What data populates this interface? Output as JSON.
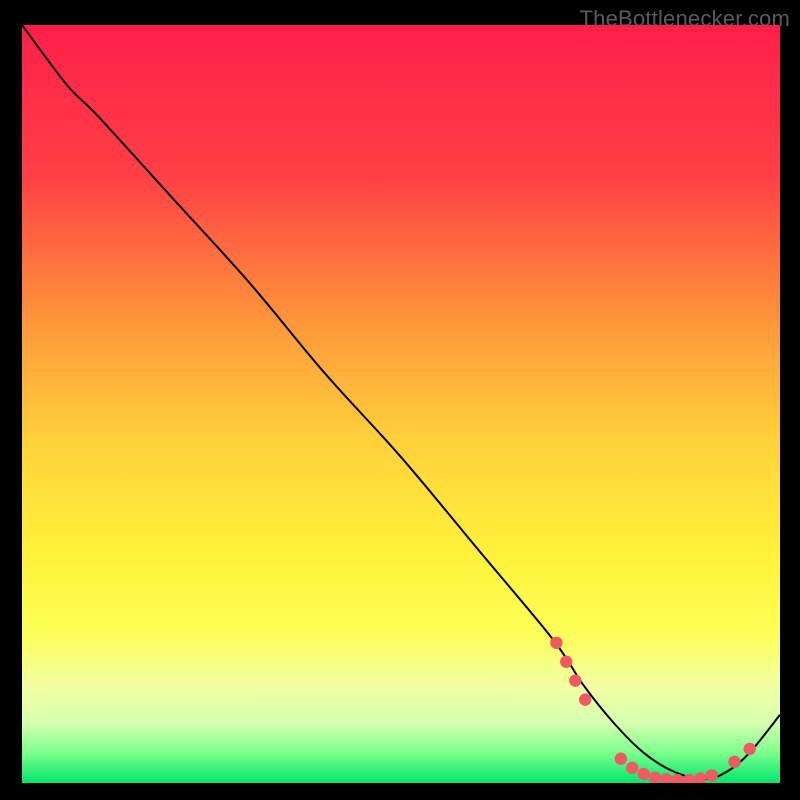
{
  "watermark": "TheBottlenecker.com",
  "chart_data": {
    "type": "line",
    "title": "",
    "xlabel": "",
    "ylabel": "",
    "xlim": [
      0,
      100
    ],
    "ylim": [
      0,
      100
    ],
    "background_gradient": {
      "stops": [
        {
          "offset": 0,
          "color": "#ff1f4a"
        },
        {
          "offset": 20,
          "color": "#ff4045"
        },
        {
          "offset": 40,
          "color": "#ff9a3a"
        },
        {
          "offset": 55,
          "color": "#ffd23a"
        },
        {
          "offset": 70,
          "color": "#fff23a"
        },
        {
          "offset": 80,
          "color": "#fdff55"
        },
        {
          "offset": 87,
          "color": "#f3ffa0"
        },
        {
          "offset": 92,
          "color": "#d6ffb0"
        },
        {
          "offset": 96,
          "color": "#7cff8c"
        },
        {
          "offset": 100,
          "color": "#00e66c"
        }
      ]
    },
    "series": [
      {
        "name": "curve",
        "color": "#000000",
        "x": [
          0,
          6,
          10,
          20,
          30,
          40,
          50,
          60,
          70,
          74,
          78,
          82,
          86,
          90,
          93,
          96,
          100
        ],
        "y": [
          100,
          92,
          88,
          77,
          66,
          54,
          43,
          31,
          19,
          13,
          8,
          4,
          1.5,
          0.5,
          1.5,
          4,
          9
        ]
      }
    ],
    "markers": {
      "name": "highlight-dots",
      "color": "#ef5a63",
      "points": [
        {
          "x": 70.5,
          "y": 18.5
        },
        {
          "x": 71.8,
          "y": 16.0
        },
        {
          "x": 73.0,
          "y": 13.5
        },
        {
          "x": 74.3,
          "y": 11.0
        },
        {
          "x": 79.0,
          "y": 3.2
        },
        {
          "x": 80.5,
          "y": 2.0
        },
        {
          "x": 82.0,
          "y": 1.2
        },
        {
          "x": 83.5,
          "y": 0.7
        },
        {
          "x": 85.0,
          "y": 0.5
        },
        {
          "x": 86.5,
          "y": 0.4
        },
        {
          "x": 88.0,
          "y": 0.4
        },
        {
          "x": 89.5,
          "y": 0.6
        },
        {
          "x": 91.0,
          "y": 1.0
        },
        {
          "x": 94.0,
          "y": 2.8
        },
        {
          "x": 96.0,
          "y": 4.5
        }
      ]
    }
  }
}
